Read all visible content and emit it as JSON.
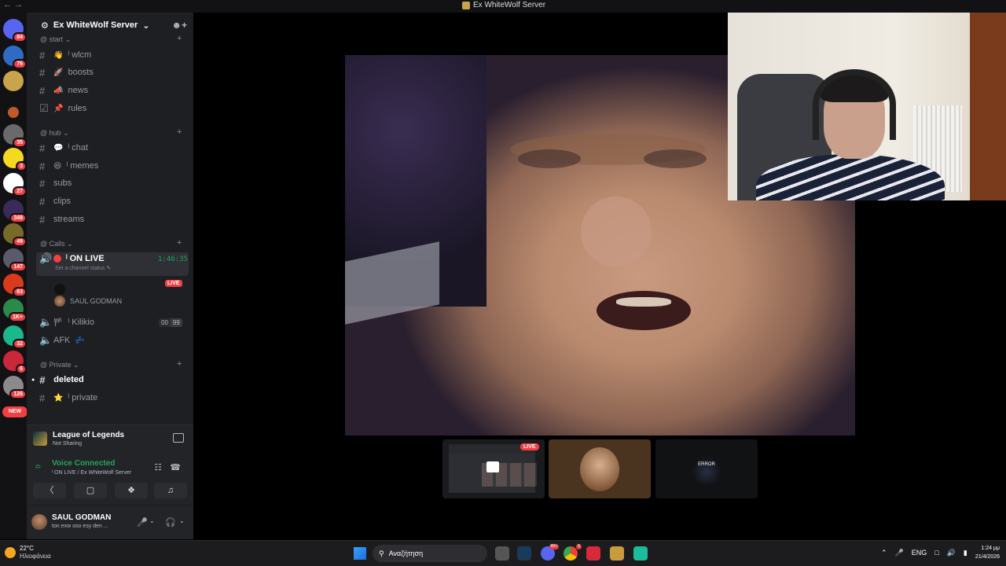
{
  "window": {
    "title": "Ex WhiteWolf Server",
    "nav": "← →"
  },
  "rail": {
    "badges": [
      "84",
      "76",
      "35",
      "3",
      "27",
      "348",
      "49",
      "147",
      "63",
      "1K+",
      "32",
      "6",
      "126"
    ],
    "new_label": "NEW"
  },
  "server": {
    "name": "Ex WhiteWolf Server",
    "chevron": "⌄"
  },
  "categories": {
    "start": "@ start",
    "hub": "@ hub",
    "calls": "@ Calls",
    "private": "@ Private"
  },
  "channels": {
    "wlcm": "ˡ wlcm",
    "boosts": "boosts",
    "news": "news",
    "rules": "rules",
    "chat": "ˡ chat",
    "memes": "ˡ memes",
    "subs": "subs",
    "clips": "clips",
    "streams": "streams",
    "on_live": "ˡ ON LIVE",
    "kilikio": "ˡ Kilikio",
    "afk": "AFK",
    "deleted": "deleted",
    "private": "ˡ private"
  },
  "voice_channel": {
    "timer": "1:46:35",
    "set_status": "Set a channel status",
    "live": "LIVE",
    "member_saul": "SAUL GODMAN",
    "kilikio_count_a": "00",
    "kilikio_count_b": "99"
  },
  "activity": {
    "game": "League of Legends",
    "sub": "Not Sharing"
  },
  "voice": {
    "state": "Voice Connected",
    "location": "ˡ ON LIVE / Ex WhiteWolf Server"
  },
  "user": {
    "name": "SAUL GODMAN",
    "status": "ton exw oso esy den ..."
  },
  "stage": {
    "thumb_live": "LIVE",
    "thumb_error": "ERROR"
  },
  "taskbar": {
    "temp": "22°C",
    "condition": "Ηλιοφάνεια",
    "search_placeholder": "Αναζήτηση",
    "discord_badge": "99+",
    "chrome_badge": "5",
    "lang": "ENG",
    "time": "1:24 μμ",
    "date": "21/4/2026"
  },
  "colors": {
    "accent_green": "#23a55a",
    "live_red": "#f23f43",
    "sidebar_bg": "#1e1f22"
  }
}
